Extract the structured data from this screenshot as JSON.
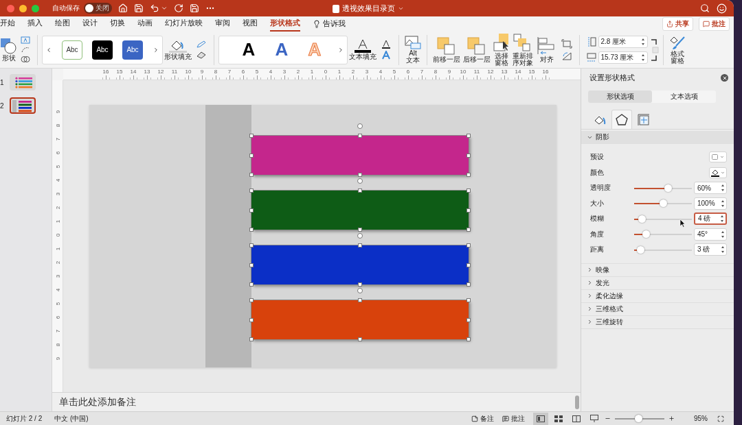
{
  "title_bar": {
    "autosave_label": "自动保存",
    "autosave_toggle": {
      "label": "关闭",
      "on": false
    },
    "document_title": "透视效果目录页"
  },
  "menu_tabs": [
    {
      "label": "开始",
      "selected": false
    },
    {
      "label": "插入",
      "selected": false
    },
    {
      "label": "绘图",
      "selected": false
    },
    {
      "label": "设计",
      "selected": false
    },
    {
      "label": "切换",
      "selected": false
    },
    {
      "label": "动画",
      "selected": false
    },
    {
      "label": "幻灯片放映",
      "selected": false
    },
    {
      "label": "审阅",
      "selected": false
    },
    {
      "label": "视图",
      "selected": false
    },
    {
      "label": "形状格式",
      "selected": true
    }
  ],
  "tell_me": "告诉我",
  "share_button": "共享",
  "comments_button": "批注",
  "ribbon": {
    "shape_button": "形状",
    "style_gallery": [
      {
        "kind": "outline",
        "label": "Abc"
      },
      {
        "kind": "dark",
        "label": "Abc"
      },
      {
        "kind": "accent",
        "label": "Abc"
      }
    ],
    "shape_fill": "形状填充",
    "wordart_gallery": [
      {
        "kind": "solid",
        "label": "A"
      },
      {
        "kind": "accent",
        "label": "A"
      },
      {
        "kind": "outline",
        "label": "A"
      }
    ],
    "text_fill": "文本填充",
    "alt_text": "Alt\n文本",
    "arrange": [
      {
        "kind": "forward",
        "label": "前移一层"
      },
      {
        "kind": "backward",
        "label": "后移一层"
      },
      {
        "kind": "pane",
        "label": "选择窗格"
      },
      {
        "kind": "reorder",
        "label": "重新排序对象"
      },
      {
        "kind": "align",
        "label": "对齐"
      }
    ],
    "height_value": "2.8 厘米",
    "width_value": "15.73 厘米",
    "format_pane": "格式窗格"
  },
  "slides": [
    {
      "number": "1",
      "kind": "list",
      "selected": false
    },
    {
      "number": "2",
      "kind": "bars",
      "selected": true
    }
  ],
  "ruler": {
    "horizontal": [
      "16",
      "15",
      "14",
      "13",
      "12",
      "11",
      "10",
      "9",
      "8",
      "7",
      "6",
      "5",
      "4",
      "3",
      "2",
      "1",
      "0",
      "1",
      "2",
      "3",
      "4",
      "5",
      "6",
      "7",
      "8",
      "9",
      "10",
      "11",
      "12",
      "13",
      "14",
      "15",
      "16"
    ],
    "vertical": [
      "9",
      "8",
      "7",
      "6",
      "5",
      "4",
      "3",
      "2",
      "1",
      "0",
      "1",
      "2",
      "3",
      "4",
      "5",
      "6",
      "7",
      "8",
      "9"
    ]
  },
  "shapes": [
    {
      "color": "#c4268c",
      "selected": true
    },
    {
      "color": "#0e5c16",
      "selected": true
    },
    {
      "color": "#0b2fc6",
      "selected": true
    },
    {
      "color": "#d8420c",
      "selected": true
    }
  ],
  "notes": {
    "placeholder": "单击此处添加备注"
  },
  "format_pane": {
    "title": "设置形状格式",
    "tabs": [
      {
        "label": "形状选项",
        "selected": true
      },
      {
        "label": "文本选项",
        "selected": false
      }
    ],
    "icon_tabs": [
      {
        "kind": "fill",
        "selected": false
      },
      {
        "kind": "effects",
        "selected": true
      },
      {
        "kind": "layout",
        "selected": false
      }
    ],
    "sections": [
      {
        "label": "阴影",
        "expanded": true,
        "rows": [
          {
            "kind": "preset",
            "label": "预设"
          },
          {
            "kind": "color",
            "label": "颜色"
          },
          {
            "kind": "slider",
            "label": "透明度",
            "level": 0.6,
            "value": "60%",
            "focused": false
          },
          {
            "kind": "slider",
            "label": "大小",
            "level": 0.5,
            "value": "100%",
            "focused": false
          },
          {
            "kind": "slider",
            "label": "模糊",
            "level": 0.08,
            "value": "4 磅",
            "focused": true
          },
          {
            "kind": "slider",
            "label": "角度",
            "level": 0.17,
            "value": "45°",
            "focused": false
          },
          {
            "kind": "slider",
            "label": "距离",
            "level": 0.06,
            "value": "3 磅",
            "focused": false
          }
        ]
      },
      {
        "label": "映像",
        "expanded": false
      },
      {
        "label": "发光",
        "expanded": false
      },
      {
        "label": "柔化边缘",
        "expanded": false
      },
      {
        "label": "三维格式",
        "expanded": false
      },
      {
        "label": "三维旋转",
        "expanded": false
      }
    ]
  },
  "status_bar": {
    "slide_counter": "幻灯片 2 / 2",
    "language": "中文 (中国)",
    "notes_button": "备注",
    "comments_button": "批注",
    "views": [
      {
        "kind": "normal",
        "selected": true
      },
      {
        "kind": "sorter",
        "selected": false
      },
      {
        "kind": "reading",
        "selected": false
      },
      {
        "kind": "slideshow",
        "selected": false
      }
    ],
    "zoom": {
      "level": 0.48,
      "value": "95%"
    }
  }
}
